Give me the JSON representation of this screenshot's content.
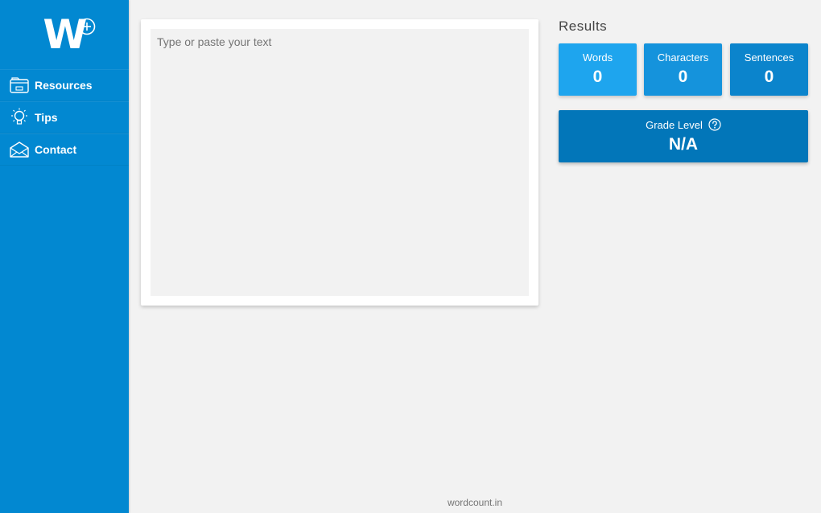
{
  "brand": {
    "logo_letter": "W"
  },
  "sidebar": {
    "items": [
      {
        "label": "Resources",
        "icon": "resources-icon"
      },
      {
        "label": "Tips",
        "icon": "lightbulb-icon"
      },
      {
        "label": "Contact",
        "icon": "envelope-icon"
      }
    ]
  },
  "editor": {
    "placeholder": "Type or paste your text",
    "value": ""
  },
  "results": {
    "title": "Results",
    "stats": [
      {
        "label": "Words",
        "value": "0"
      },
      {
        "label": "Characters",
        "value": "0"
      },
      {
        "label": "Sentences",
        "value": "0"
      }
    ],
    "grade": {
      "label": "Grade Level",
      "value": "N/A"
    }
  },
  "footer": {
    "text": "wordcount.in"
  },
  "colors": {
    "sidebar": "#0288d1",
    "words": "#1ea5ee",
    "characters": "#1593dc",
    "sentences": "#0b84cc",
    "grade": "#0276b9",
    "background": "#f2f2f2"
  }
}
